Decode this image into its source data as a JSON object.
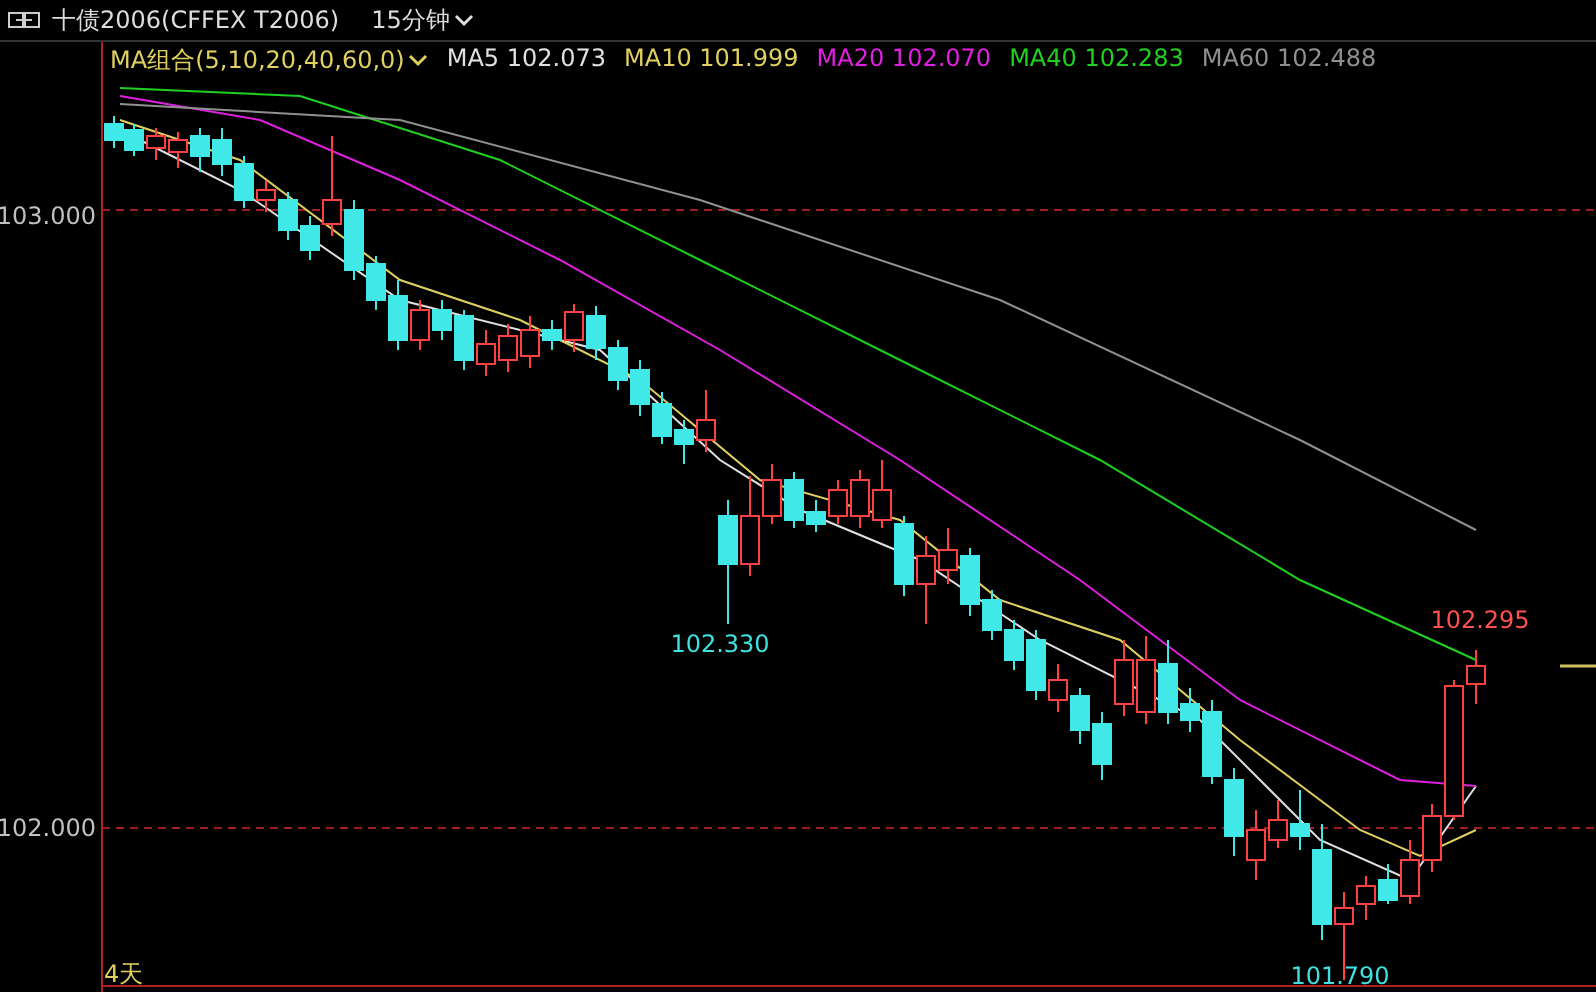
{
  "header": {
    "title": "十债2006(CFFEX T2006)",
    "period": "15分钟"
  },
  "legend": {
    "label": "MA组合(5,10,20,40,60,0)",
    "items": [
      {
        "text": "MA5 102.073",
        "color": "#e0e0e0"
      },
      {
        "text": "MA10 101.999",
        "color": "#e0d060"
      },
      {
        "text": "MA20 102.070",
        "color": "#e020e0"
      },
      {
        "text": "MA40 102.283",
        "color": "#20d020"
      },
      {
        "text": "MA60 102.488",
        "color": "#909090"
      }
    ]
  },
  "y_axis": [
    "103.000",
    "102.000"
  ],
  "annotations": [
    {
      "text": "102.330",
      "kind": "low"
    },
    {
      "text": "102.295",
      "kind": "high"
    },
    {
      "text": "101.790",
      "kind": "low"
    }
  ],
  "range_label": "4天"
}
